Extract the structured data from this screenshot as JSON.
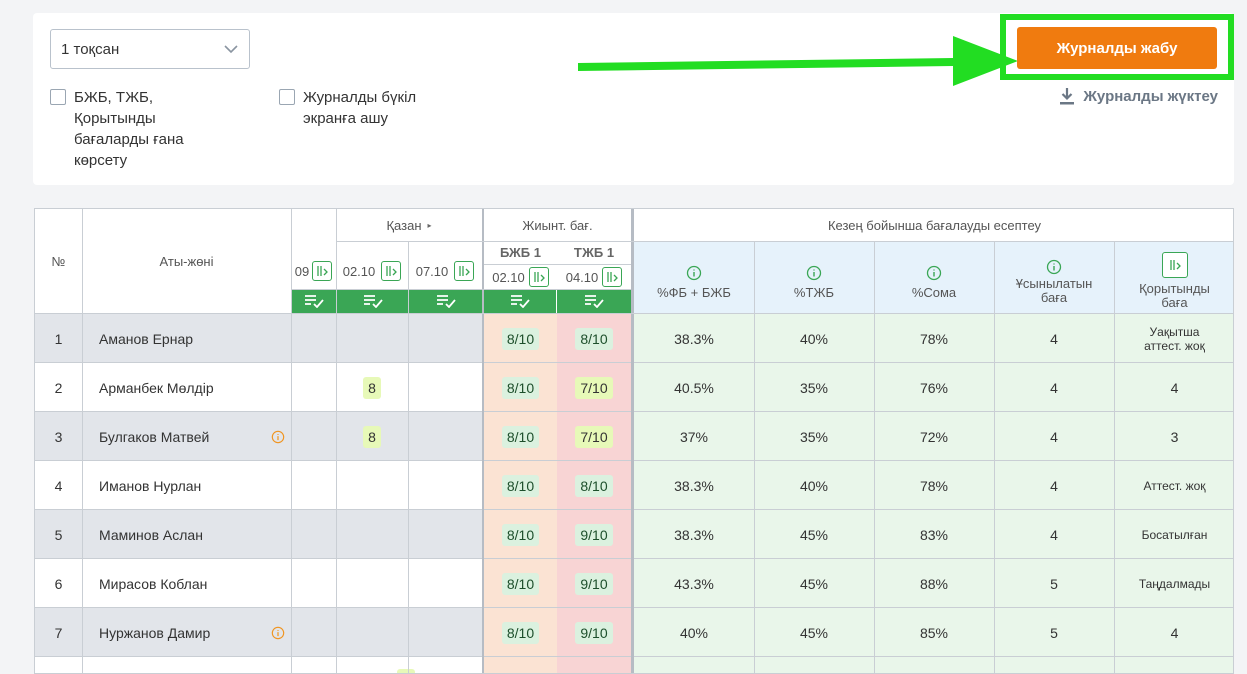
{
  "controls": {
    "period_select": "1 тоқсан",
    "checkbox_filter_label": "БЖБ, ТЖБ, Қорытынды бағаларды ғана көрсету",
    "checkbox_fullscreen_label": "Журналды бүкіл экранға ашу",
    "close_button_label": "Журналды жабу",
    "download_label": "Журналды жүктеу"
  },
  "table": {
    "col_no": "№",
    "col_name": "Аты-жөні",
    "month_label": "Қазан",
    "summative_label": "Жиынт. бағ.",
    "period_calc_label": "Кезең бойынша бағалауды есептеу",
    "dates": [
      "09",
      "02.10",
      "07.10"
    ],
    "bzb_label": "БЖБ 1",
    "bzb_date": "02.10",
    "tzb_label": "ТЖБ 1",
    "tzb_date": "04.10",
    "calc_headers": [
      "%ФБ + БЖБ",
      "%ТЖБ",
      "%Сома",
      "Ұсынылатын баға",
      "Қорытынды баға"
    ],
    "rows": [
      {
        "no": "1",
        "name": "Аманов Ернар",
        "d2": "",
        "bzb": "8/10",
        "tzb": "8/10",
        "fb": "38.3%",
        "tzb_pct": "40%",
        "sum": "78%",
        "rec": "4",
        "final": "Уақытша аттест. жоқ"
      },
      {
        "no": "2",
        "name": "Арманбек Мөлдір",
        "d2": "8",
        "bzb": "8/10",
        "tzb": "7/10",
        "fb": "40.5%",
        "tzb_pct": "35%",
        "sum": "76%",
        "rec": "4",
        "final": "4"
      },
      {
        "no": "3",
        "name": "Булгаков Матвей",
        "d2": "8",
        "bzb": "8/10",
        "tzb": "7/10",
        "fb": "37%",
        "tzb_pct": "35%",
        "sum": "72%",
        "rec": "4",
        "final": "3"
      },
      {
        "no": "4",
        "name": "Иманов Нурлан",
        "d2": "",
        "bzb": "8/10",
        "tzb": "8/10",
        "fb": "38.3%",
        "tzb_pct": "40%",
        "sum": "78%",
        "rec": "4",
        "final": "Аттест. жоқ"
      },
      {
        "no": "5",
        "name": "Маминов Аслан",
        "d2": "",
        "bzb": "8/10",
        "tzb": "9/10",
        "fb": "38.3%",
        "tzb_pct": "45%",
        "sum": "83%",
        "rec": "4",
        "final": "Босатылған"
      },
      {
        "no": "6",
        "name": "Мирасов Коблан",
        "d2": "",
        "bzb": "8/10",
        "tzb": "9/10",
        "fb": "43.3%",
        "tzb_pct": "45%",
        "sum": "88%",
        "rec": "5",
        "final": "Таңдалмады"
      },
      {
        "no": "7",
        "name": "Нуржанов Дамир",
        "d2": "",
        "bzb": "8/10",
        "tzb": "9/10",
        "fb": "40%",
        "tzb_pct": "45%",
        "sum": "85%",
        "rec": "5",
        "final": "4"
      }
    ]
  },
  "colors": {
    "accent_orange": "#f07b0f",
    "highlight_green": "#22dd22",
    "bar_green": "#3aa655"
  }
}
